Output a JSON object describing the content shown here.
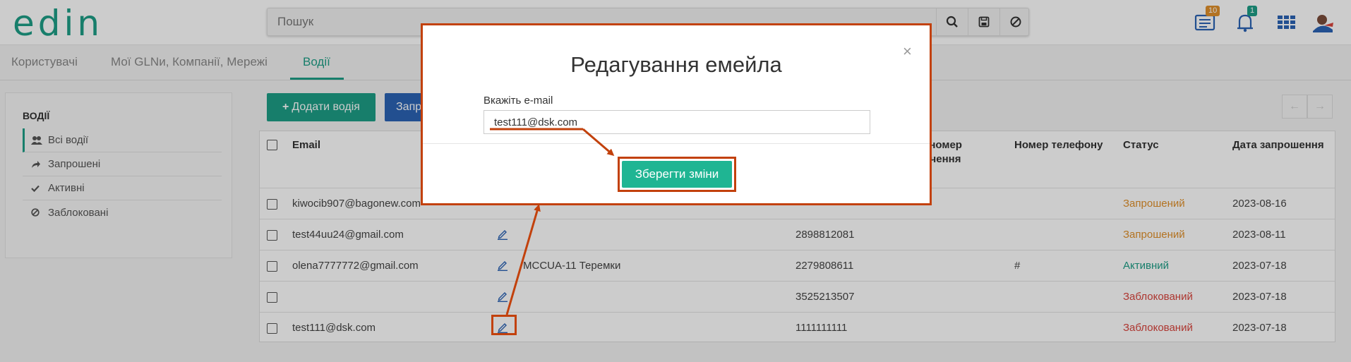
{
  "header": {
    "logo": "edin",
    "search_placeholder": "Пошук",
    "icons": [
      "search-icon",
      "save-icon",
      "clear-icon",
      "news-icon",
      "bell-icon",
      "apps-grid-icon",
      "avatar"
    ],
    "news_badge": "10",
    "notifications_badge": "1"
  },
  "tabs": [
    {
      "label": "Користувачі"
    },
    {
      "label": "Мої GLNи, Компанії, Мережі"
    },
    {
      "label": "Водії"
    }
  ],
  "sidebar": {
    "title": "ВОДІЇ",
    "items": [
      {
        "label": "Всі водії",
        "icon": "users-icon"
      },
      {
        "label": "Запрошені",
        "icon": "share-icon"
      },
      {
        "label": "Активні",
        "icon": "check-icon"
      },
      {
        "label": "Заблоковані",
        "icon": "ban-icon"
      }
    ]
  },
  "actions": {
    "add_driver": "Додати водія",
    "invite": "Запр"
  },
  "table": {
    "headers": {
      "email": "Email",
      "id_line1": ", номер",
      "id_line2": "дчення",
      "id_line3": "н",
      "phone": "Номер телефону",
      "status": "Статус",
      "invite_date": "Дата запрошення"
    },
    "rows": [
      {
        "email": "kiwocib907@bagonew.com",
        "company": "",
        "id": "",
        "phone": "",
        "status": "Запрошений",
        "date": "2023-08-16"
      },
      {
        "email": "test44uu24@gmail.com",
        "company": "",
        "id": "2898812081",
        "phone": "",
        "status": "Запрошений",
        "date": "2023-08-11"
      },
      {
        "email": "olena7777772@gmail.com",
        "company": "МССUA-11 Теремки",
        "id": "2279808611",
        "phone": "#",
        "status": "Активний",
        "date": "2023-07-18"
      },
      {
        "email": "",
        "company": "",
        "id": "3525213507",
        "phone": "",
        "status": "Заблокований",
        "date": "2023-07-18"
      },
      {
        "email": "test111@dsk.com",
        "company": "",
        "id": "1111111111",
        "phone": "",
        "status": "Заблокований",
        "date": "2023-07-18"
      }
    ]
  },
  "modal": {
    "title": "Редагування емейла",
    "close": "×",
    "email_label": "Вкажіть e-mail",
    "email_value": "test111@dsk.com",
    "save_label": "Зберегти зміни"
  },
  "colors": {
    "brand": "#1d9e86",
    "save_button": "#1fb593",
    "invite_button": "#2b63b5",
    "highlight": "#c2410c",
    "status_invited": "#e0902b",
    "status_active": "#1d9e86",
    "status_blocked": "#d9443c"
  }
}
